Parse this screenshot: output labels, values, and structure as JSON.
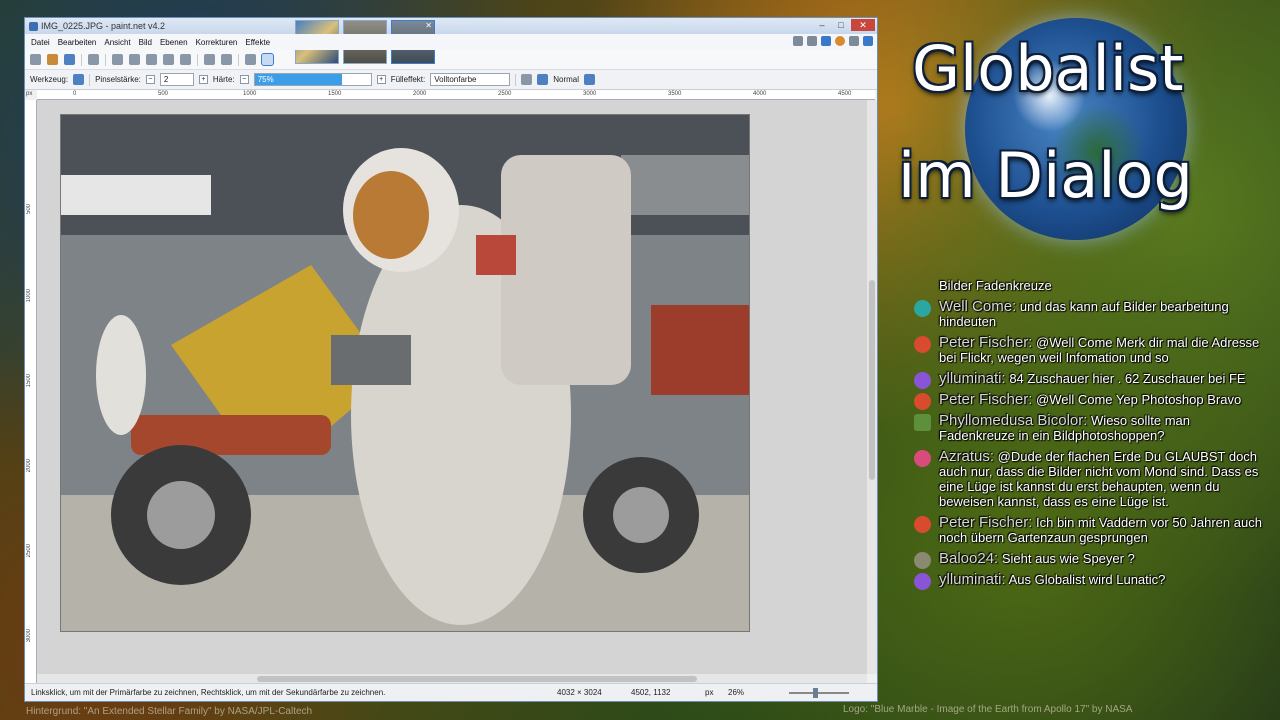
{
  "window": {
    "title": "IMG_0225.JPG - paint.net v4.2",
    "menu": [
      "Datei",
      "Bearbeiten",
      "Ansicht",
      "Bild",
      "Ebenen",
      "Korrekturen",
      "Effekte"
    ]
  },
  "toolbar": {
    "tool_label": "Werkzeug:",
    "brush_width_label": "Pinselstärke:",
    "brush_width_value": "2",
    "hardness_label": "Härte:",
    "hardness_value": "75%",
    "fill_label": "Fülleffekt:",
    "fill_value": "Volltonfarbe",
    "blend_value": "Normal"
  },
  "ruler": {
    "unit": "px",
    "h_ticks": [
      "0",
      "500",
      "1000",
      "1500",
      "2000",
      "2500",
      "3000",
      "3500",
      "4000",
      "4500"
    ],
    "v_ticks": [
      "500",
      "1000",
      "1500",
      "2000",
      "2500",
      "3000"
    ]
  },
  "status": {
    "hint": "Linksklick, um mit der Primärfarbe zu zeichnen, Rechtsklick, um mit der Sekundärfarbe zu zeichnen.",
    "image_size": "4032 × 3024",
    "cursor_pos": "4502, 1132",
    "unit": "px",
    "zoom": "26%"
  },
  "logo": {
    "line1": "Globalist",
    "line2": "im Dialog"
  },
  "chat": {
    "first_text": "Bilder Fadenkreuze",
    "messages": [
      {
        "name": "Well Come:",
        "text": "und das kann auf Bilder bearbeitung hindeuten",
        "color": "#2aa7a0"
      },
      {
        "name": "Peter Fischer:",
        "text": "@Well Come Merk dir mal die Adresse bei Flickr, wegen weil Infomation und so",
        "color": "#d84b2e"
      },
      {
        "name": "ylluminati:",
        "text": "84 Zuschauer hier . 62 Zuschauer bei FE",
        "color": "#8a54d6"
      },
      {
        "name": "Peter Fischer:",
        "text": "@Well Come Yep Photoshop Bravo",
        "color": "#d84b2e"
      },
      {
        "name": "Phyllomedusa Bicolor:",
        "text": "Wieso sollte man Fadenkreuze in ein Bildphotoshoppen?",
        "color": "#5e8f3a"
      },
      {
        "name": "Azratus:",
        "text": "@Dude der flachen Erde Du GLAUBST doch auch nur, dass die Bilder nicht vom Mond sind. Dass es eine Lüge ist kannst du erst behaupten, wenn du beweisen kannst, dass es eine Lüge ist.",
        "color": "#d84b7a"
      },
      {
        "name": "Peter Fischer:",
        "text": "Ich bin mit Vaddern vor 50 Jahren auch noch übern Gartenzaun gesprungen",
        "color": "#d84b2e"
      },
      {
        "name": "Baloo24:",
        "text": "Sieht aus wie Speyer ?",
        "color": "#8a8a72"
      },
      {
        "name": "ylluminati:",
        "text": "Aus Globalist wird Lunatic?",
        "color": "#8a54d6"
      }
    ]
  },
  "credits": {
    "background": "Hintergrund: \"An Extended Stellar Family\" by NASA/JPL-Caltech",
    "logo": "Logo: \"Blue Marble - Image of the Earth from Apollo 17\" by NASA"
  }
}
